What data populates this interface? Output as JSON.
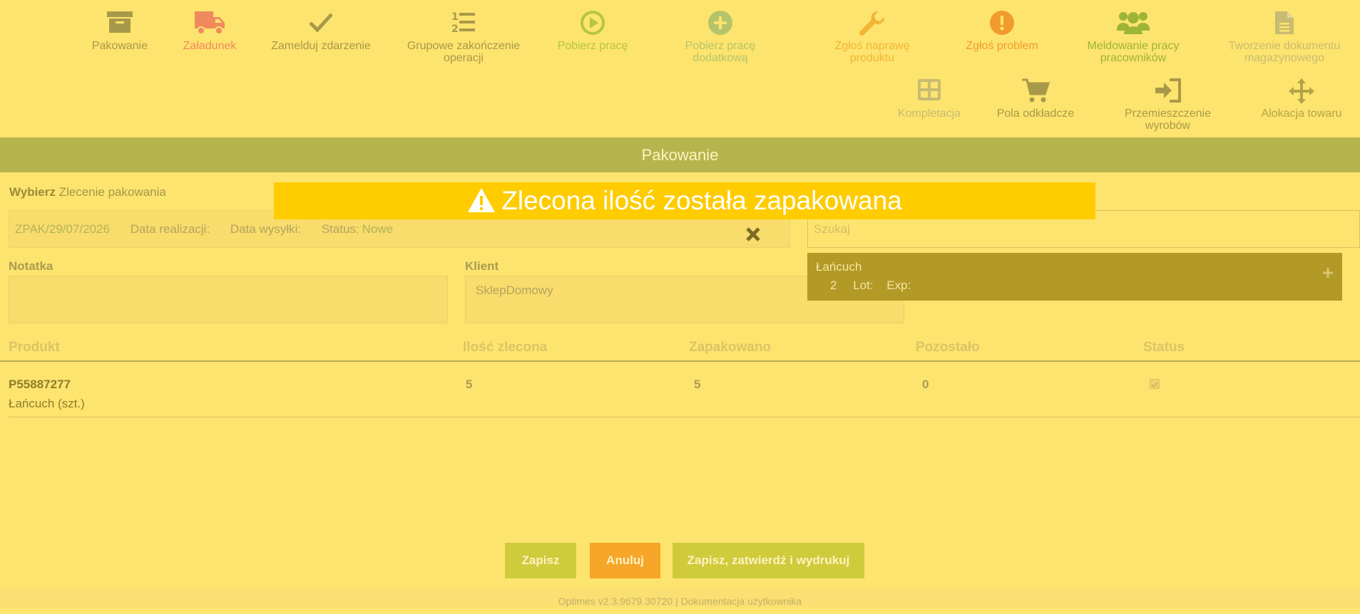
{
  "toolbar": {
    "row1": [
      {
        "label": "Pakowanie",
        "icon": "archive-icon",
        "color": "#a8994a"
      },
      {
        "label": "Załadunek",
        "icon": "truck-icon",
        "color": "#f08a5d"
      },
      {
        "label": "Zamelduj zdarzenie",
        "icon": "check-icon",
        "color": "#a8994a"
      },
      {
        "label": "Grupowe zakończenie operacji",
        "icon": "ordered-list-icon",
        "color": "#a8994a"
      },
      {
        "label": "Pobierz pracę",
        "icon": "play-circle-icon",
        "color": "#b5c73b"
      },
      {
        "label": "Pobierz pracę dodatkową",
        "icon": "plus-circle-icon",
        "color": "#b5c46a"
      },
      {
        "label": "Zgłoś naprawę produktu",
        "icon": "wrench-icon",
        "color": "#f3b436"
      },
      {
        "label": "Zgłoś problem",
        "icon": "exclamation-circle-icon",
        "color": "#f29b2c"
      },
      {
        "label": "Meldowanie pracy pracowników",
        "icon": "users-icon",
        "color": "#9cb536"
      },
      {
        "label": "Tworzenie dokumentu magazynowego",
        "icon": "document-icon",
        "color": "#c9bb72"
      }
    ],
    "row2": [
      {
        "label": "Kompletacja",
        "icon": "grid-icon",
        "color": "#c9bb72"
      },
      {
        "label": "Pola odkładcze",
        "icon": "cart-icon",
        "color": "#a8994a"
      },
      {
        "label": "Przemieszczenie wyrobów",
        "icon": "sign-in-icon",
        "color": "#a8994a"
      },
      {
        "label": "Alokacja towaru",
        "icon": "move-icon",
        "color": "#b3a446"
      }
    ]
  },
  "section_title": "Pakowanie",
  "select": {
    "prefix": "Wybierz",
    "label": "Zlecenie pakowania"
  },
  "order": {
    "code": "ZPAK/29/07/2026",
    "realization_label": "Data realizacji:",
    "shipping_label": "Data wysyłki:",
    "status_label": "Status:",
    "status_value": "Nowe"
  },
  "note": {
    "label": "Notatka",
    "value": ""
  },
  "client": {
    "label": "Klient",
    "value": "SklepDomowy"
  },
  "search": {
    "placeholder": "Szukaj"
  },
  "result": {
    "name": "Łańcuch",
    "qty": "2",
    "lot_label": "Lot:",
    "exp_label": "Exp:"
  },
  "banner": {
    "text": "Zlecona ilość została zapakowana"
  },
  "table": {
    "headers": [
      "Produkt",
      "Ilość zlecona",
      "Zapakowano",
      "Pozostało",
      "Status"
    ],
    "rows": [
      {
        "code": "P55887277",
        "name": "Łańcuch (szt.)",
        "ordered": "5",
        "packed": "5",
        "remaining": "0",
        "status_checked": true
      }
    ]
  },
  "buttons": {
    "save": "Zapisz",
    "cancel": "Anuluj",
    "save_confirm_print": "Zapisz, zatwierdź i wydrukuj"
  },
  "footer": {
    "version": "Optimes v2.3.9679.30720",
    "separator": "|",
    "docs": "Dokumentacja użytkownika"
  }
}
